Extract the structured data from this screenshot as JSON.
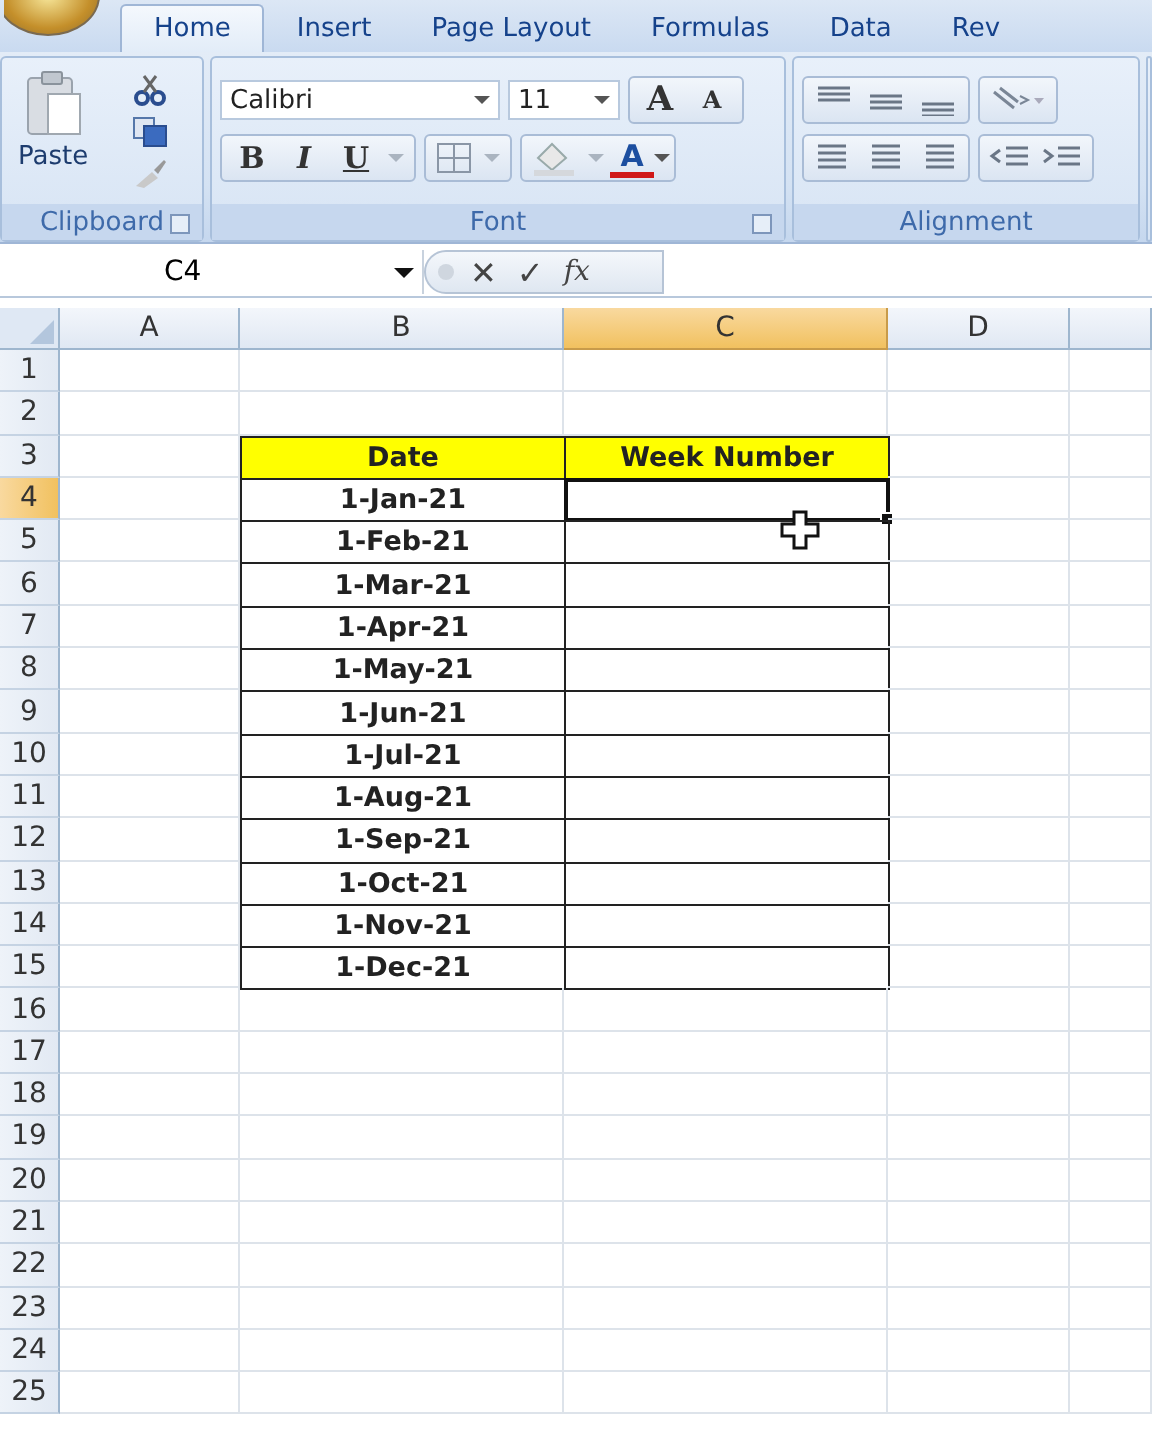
{
  "tabs": [
    {
      "label": "Home",
      "selected": true
    },
    {
      "label": "Insert",
      "selected": false
    },
    {
      "label": "Page Layout",
      "selected": false
    },
    {
      "label": "Formulas",
      "selected": false
    },
    {
      "label": "Data",
      "selected": false
    },
    {
      "label": "Rev",
      "selected": false
    }
  ],
  "ribbon": {
    "paste_label": "Paste",
    "font_name": "Calibri",
    "font_size": "11",
    "grow_letters": [
      "A",
      "A"
    ],
    "style_buttons": [
      "B",
      "I",
      "U"
    ],
    "font_color_letter": "A",
    "groups": [
      "Clipboard",
      "Font",
      "Alignment"
    ]
  },
  "formula_bar": {
    "name_box": "C4",
    "buttons": [
      "✕",
      "✓",
      "fx"
    ]
  },
  "columns": [
    {
      "label": "A",
      "selected": false
    },
    {
      "label": "B",
      "selected": false
    },
    {
      "label": "C",
      "selected": true
    },
    {
      "label": "D",
      "selected": false
    }
  ],
  "rows": [
    {
      "number": "1",
      "selected": false
    },
    {
      "number": "2",
      "selected": false
    },
    {
      "number": "3",
      "selected": false
    },
    {
      "number": "4",
      "selected": true
    },
    {
      "number": "5",
      "selected": false
    },
    {
      "number": "6",
      "selected": false
    },
    {
      "number": "7",
      "selected": false
    },
    {
      "number": "8",
      "selected": false
    },
    {
      "number": "9",
      "selected": false
    },
    {
      "number": "10",
      "selected": false
    },
    {
      "number": "11",
      "selected": false
    },
    {
      "number": "12",
      "selected": false
    },
    {
      "number": "13",
      "selected": false
    },
    {
      "number": "14",
      "selected": false
    },
    {
      "number": "15",
      "selected": false
    },
    {
      "number": "16",
      "selected": false
    },
    {
      "number": "17",
      "selected": false
    },
    {
      "number": "18",
      "selected": false
    },
    {
      "number": "19",
      "selected": false
    },
    {
      "number": "20",
      "selected": false
    },
    {
      "number": "21",
      "selected": false
    },
    {
      "number": "22",
      "selected": false
    },
    {
      "number": "23",
      "selected": false
    },
    {
      "number": "24",
      "selected": false
    },
    {
      "number": "25",
      "selected": false
    }
  ],
  "table": {
    "headers": [
      "Date",
      "Week Number"
    ],
    "rows": [
      {
        "date": "1-Jan-21",
        "selected": true
      },
      {
        "date": "1-Feb-21",
        "selected": false
      },
      {
        "date": "1-Mar-21",
        "selected": false
      },
      {
        "date": "1-Apr-21",
        "selected": false
      },
      {
        "date": "1-May-21",
        "selected": false
      },
      {
        "date": "1-Jun-21",
        "selected": false
      },
      {
        "date": "1-Jul-21",
        "selected": false
      },
      {
        "date": "1-Aug-21",
        "selected": false
      },
      {
        "date": "1-Sep-21",
        "selected": false
      },
      {
        "date": "1-Oct-21",
        "selected": false
      },
      {
        "date": "1-Nov-21",
        "selected": false
      },
      {
        "date": "1-Dec-21",
        "selected": false
      }
    ]
  }
}
